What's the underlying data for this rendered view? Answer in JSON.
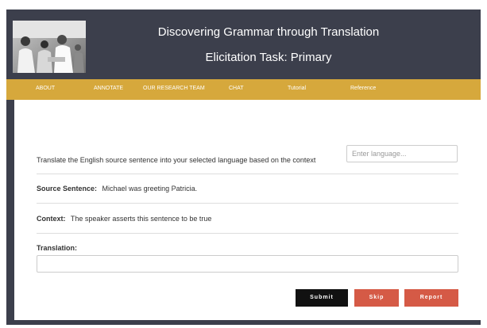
{
  "header": {
    "title": "Discovering Grammar through Translation",
    "subtitle": "Elicitation Task: Primary"
  },
  "nav": {
    "items": [
      {
        "label": "ABOUT"
      },
      {
        "label": "ANNOTATE"
      },
      {
        "label": "OUR RESEARCH TEAM"
      },
      {
        "label": "CHAT"
      },
      {
        "label": "Tutorial"
      },
      {
        "label": "Reference"
      }
    ]
  },
  "task": {
    "instruction": "Translate the English source sentence into your selected language based on the context",
    "language_placeholder": "Enter language...",
    "language_value": "",
    "source_label": "Source Sentence:",
    "source_value": "Michael was greeting Patricia.",
    "context_label": "Context:",
    "context_value": "The speaker asserts this sentence to be true",
    "translation_label": "Translation:",
    "translation_value": ""
  },
  "buttons": {
    "submit": "Submit",
    "skip": "Skip",
    "report": "Report"
  },
  "colors": {
    "header_bg": "#3c3f4c",
    "nav_bg": "#d6a83c",
    "submit_bg": "#111111",
    "danger_bg": "#d55a46"
  }
}
